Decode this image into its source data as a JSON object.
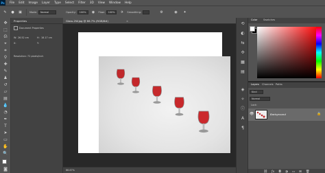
{
  "menu": {
    "logo": "Ps",
    "items": [
      "File",
      "Edit",
      "Image",
      "Layer",
      "Type",
      "Select",
      "Filter",
      "3D",
      "View",
      "Window",
      "Help"
    ]
  },
  "options": {
    "mode_label": "Mode:",
    "mode_value": "Normal",
    "opacity_label": "Opacity:",
    "opacity_value": "100%",
    "flow_label": "Flow:",
    "flow_value": "100%",
    "smoothing_label": "Smoothing:"
  },
  "document": {
    "tab_title": "Glass-2W.jpg @ 66.7% (RGB/8#)",
    "zoom": "66.67%"
  },
  "properties": {
    "tab_label": "Properties",
    "section_label": "Document Properties",
    "w_label": "W:",
    "w_value": "26.52 cm",
    "h_label": "H:",
    "h_value": "18.17 cm",
    "x_label": "X:",
    "y_label": "Y:",
    "resolution": "Resolution: 72 pixels/inch"
  },
  "color_panel": {
    "tabs": [
      "Color",
      "Swatches"
    ],
    "accent": "#ff0000"
  },
  "layers_panel": {
    "tabs": [
      "Layers",
      "Channels",
      "Paths"
    ],
    "kind_label": "Kind",
    "mode_value": "Normal",
    "lock_label": "Lock:",
    "layer_name": "Background"
  },
  "icons": {
    "tools": [
      "move-tool-icon",
      "marquee-tool-icon",
      "lasso-tool-icon",
      "quick-select-icon",
      "crop-tool-icon",
      "eyedropper-icon",
      "healing-brush-icon",
      "brush-tool-icon",
      "stamp-tool-icon",
      "history-brush-icon",
      "eraser-icon",
      "gradient-tool-icon",
      "blur-tool-icon",
      "dodge-tool-icon",
      "pen-tool-icon",
      "type-tool-icon",
      "path-select-icon",
      "shape-tool-icon",
      "hand-tool-icon",
      "zoom-tool-icon"
    ]
  }
}
